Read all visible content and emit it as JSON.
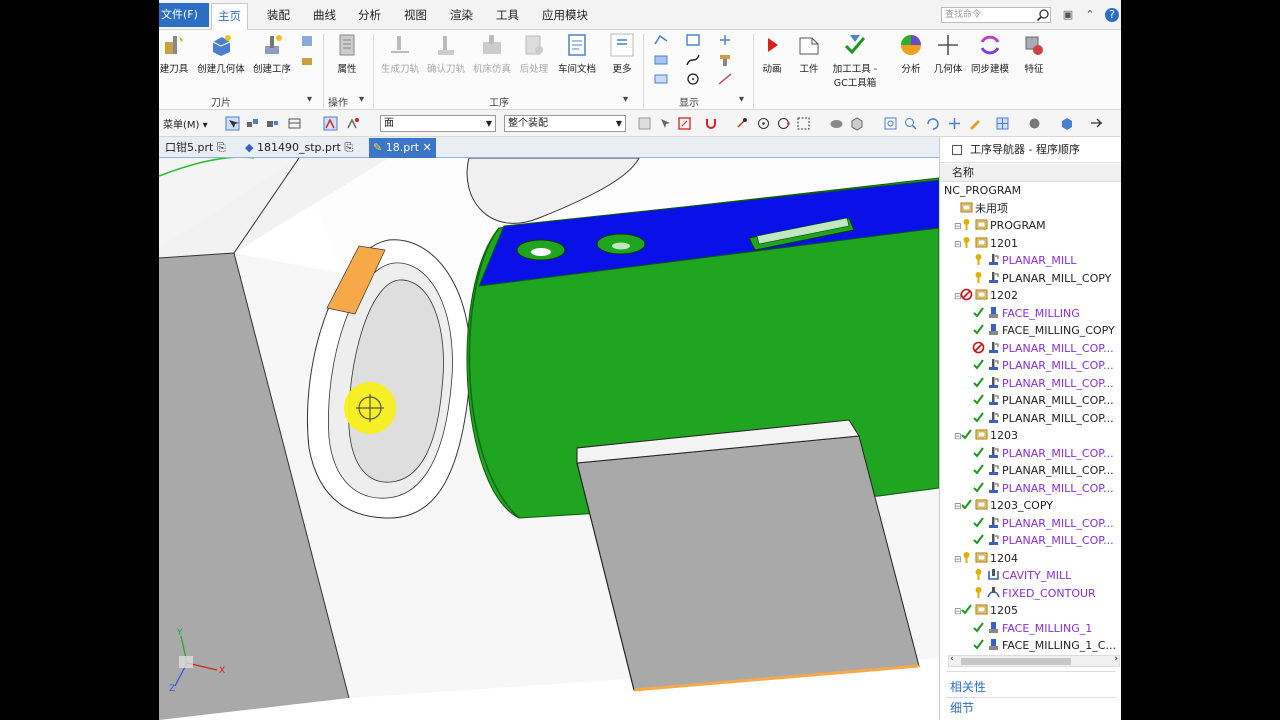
{
  "menubar": {
    "file_tab": "文件(F)",
    "items": [
      "主页",
      "装配",
      "曲线",
      "分析",
      "视图",
      "渲染",
      "工具",
      "应用模块"
    ],
    "search_placeholder": "查找命令"
  },
  "ribbon": {
    "tool_group": {
      "label": "刀片",
      "buttons": [
        "建刀具",
        "创建几何体",
        "创建工序"
      ]
    },
    "operation_group": {
      "label": "操作",
      "buttons": [
        "属性"
      ]
    },
    "process_group": {
      "label": "工序",
      "buttons": [
        "生成刀轨",
        "确认刀轨",
        "机床仿真",
        "后处理",
        "车间文档",
        "更多"
      ]
    },
    "display_group": {
      "label": "显示"
    },
    "right_buttons": [
      "动画",
      "工件",
      "加工工具 -",
      "GC工具箱",
      "分析",
      "几何体",
      "同步建模",
      "特征"
    ]
  },
  "selection_bar": {
    "menu_label": "菜单(M)",
    "filter_value": "面",
    "scope_value": "整个装配"
  },
  "tabs": [
    {
      "label": "口钳5.prt",
      "active": false
    },
    {
      "label": "181490_stp.prt",
      "active": false
    },
    {
      "label": "18.prt",
      "active": true
    }
  ],
  "navigator": {
    "title": "工序导航器 - 程序顺序",
    "column_header": "名称",
    "rows": [
      {
        "indent": 0,
        "label": "NC_PROGRAM",
        "color": "dark",
        "status": "none",
        "type": "root"
      },
      {
        "indent": 1,
        "label": "未用项",
        "color": "dark",
        "status": "none",
        "type": "folder"
      },
      {
        "indent": 1,
        "label": "PROGRAM",
        "color": "dark",
        "status": "warn",
        "type": "folder"
      },
      {
        "indent": 1,
        "label": "1201",
        "color": "dark",
        "status": "warn",
        "type": "folder"
      },
      {
        "indent": 2,
        "label": "PLANAR_MILL",
        "color": "purple",
        "status": "warn",
        "type": "op"
      },
      {
        "indent": 2,
        "label": "PLANAR_MILL_COPY",
        "color": "dark",
        "status": "warn",
        "type": "op"
      },
      {
        "indent": 1,
        "label": "1202",
        "color": "dark",
        "status": "error",
        "type": "folder"
      },
      {
        "indent": 2,
        "label": "FACE_MILLING",
        "color": "purple",
        "status": "ok",
        "type": "face"
      },
      {
        "indent": 2,
        "label": "FACE_MILLING_COPY",
        "color": "dark",
        "status": "ok",
        "type": "face"
      },
      {
        "indent": 2,
        "label": "PLANAR_MILL_COP...",
        "color": "purple",
        "status": "error",
        "type": "op"
      },
      {
        "indent": 2,
        "label": "PLANAR_MILL_COP...",
        "color": "purple",
        "status": "ok",
        "type": "op"
      },
      {
        "indent": 2,
        "label": "PLANAR_MILL_COP...",
        "color": "purple",
        "status": "ok",
        "type": "op"
      },
      {
        "indent": 2,
        "label": "PLANAR_MILL_COP...",
        "color": "dark",
        "status": "ok",
        "type": "op"
      },
      {
        "indent": 2,
        "label": "PLANAR_MILL_COP...",
        "color": "dark",
        "status": "ok",
        "type": "op"
      },
      {
        "indent": 1,
        "label": "1203",
        "color": "dark",
        "status": "ok",
        "type": "folder"
      },
      {
        "indent": 2,
        "label": "PLANAR_MILL_COP...",
        "color": "purple",
        "status": "ok",
        "type": "op"
      },
      {
        "indent": 2,
        "label": "PLANAR_MILL_COP...",
        "color": "dark",
        "status": "ok",
        "type": "op"
      },
      {
        "indent": 2,
        "label": "PLANAR_MILL_COP...",
        "color": "purple",
        "status": "ok",
        "type": "op"
      },
      {
        "indent": 1,
        "label": "1203_COPY",
        "color": "dark",
        "status": "ok",
        "type": "folder"
      },
      {
        "indent": 2,
        "label": "PLANAR_MILL_COP...",
        "color": "purple",
        "status": "ok",
        "type": "op"
      },
      {
        "indent": 2,
        "label": "PLANAR_MILL_COP...",
        "color": "purple",
        "status": "ok",
        "type": "op"
      },
      {
        "indent": 1,
        "label": "1204",
        "color": "dark",
        "status": "warn",
        "type": "folder"
      },
      {
        "indent": 2,
        "label": "CAVITY_MILL",
        "color": "purple",
        "status": "warn",
        "type": "cavity"
      },
      {
        "indent": 2,
        "label": "FIXED_CONTOUR",
        "color": "purple",
        "status": "warn",
        "type": "contour"
      },
      {
        "indent": 1,
        "label": "1205",
        "color": "dark",
        "status": "ok",
        "type": "folder"
      },
      {
        "indent": 2,
        "label": "FACE_MILLING_1",
        "color": "purple",
        "status": "ok",
        "type": "face"
      },
      {
        "indent": 2,
        "label": "FACE_MILLING_1_C...",
        "color": "dark",
        "status": "ok",
        "type": "face"
      }
    ],
    "bottom_panels": [
      "相关性",
      "细节"
    ]
  },
  "colors": {
    "accent": "#2b6fc4",
    "model_green": "#1fa51f",
    "model_blue": "#0a10e8",
    "model_gray": "#a9a9a9",
    "highlight_orange": "#f7a94a",
    "ok_green": "#1a9a1a",
    "error_red": "#d01010",
    "warn_yellow": "#e0b000"
  }
}
